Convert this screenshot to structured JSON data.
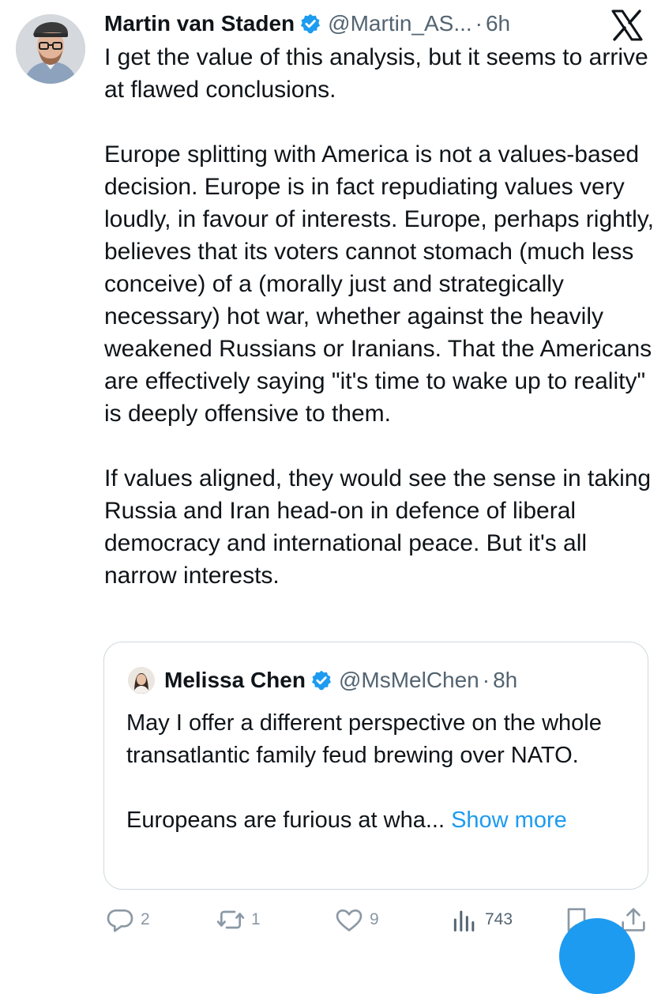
{
  "post": {
    "author_name": "Martin van Staden",
    "handle": "@Martin_AS...",
    "separator": "·",
    "time": "6h",
    "paragraphs": [
      "I get the value of this analysis, but it seems to arrive at flawed conclusions.",
      "Europe splitting with America is not a values-based decision. Europe is in fact repudiating values very loudly, in favour of interests. Europe, perhaps rightly, believes that its voters cannot stomach (much less conceive) of a (morally just and strategically necessary) hot war, whether against the heavily weakened Russians or Iranians. That the Americans are effectively saying \"it's time to wake up to reality\" is deeply offensive to them.",
      "If values aligned, they would see the sense in taking Russia and Iran head-on in defence of liberal democracy and international peace. But it's all narrow interests."
    ]
  },
  "quoted": {
    "author_name": "Melissa Chen",
    "handle": "@MsMelChen",
    "separator": "·",
    "time": "8h",
    "paragraphs": [
      "May I offer a different perspective on the whole transatlantic family feud brewing over NATO.",
      "Europeans are furious at wha..."
    ],
    "show_more": "Show more"
  },
  "actions": {
    "replies": "2",
    "reposts": "1",
    "likes": "9",
    "views": "743"
  },
  "icons": {
    "brand": "x-logo-icon",
    "verified": "verified-badge-icon",
    "reply": "reply-icon",
    "repost": "repost-icon",
    "like": "heart-icon",
    "views": "views-icon",
    "bookmark": "bookmark-icon",
    "share": "share-icon"
  },
  "colors": {
    "text": "#0f1419",
    "secondary": "#536471",
    "accent": "#1d9bf0",
    "border": "#cfd9de"
  }
}
